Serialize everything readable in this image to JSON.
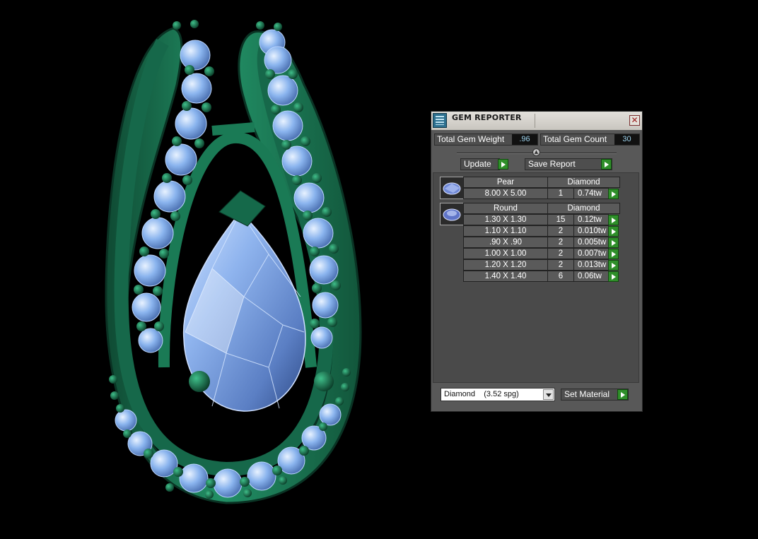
{
  "panel": {
    "title": "GEM REPORTER",
    "close_glyph": "✕",
    "total_weight_label": "Total Gem Weight",
    "total_weight_value": ".96",
    "total_count_label": "Total Gem Count",
    "total_count_value": "30",
    "update_label": "Update",
    "save_report_label": "Save Report",
    "groups": [
      {
        "icon": "pear-gem-icon",
        "shape": "Pear",
        "material": "Diamond",
        "rows": [
          {
            "size": "8.00 X 5.00",
            "count": "1",
            "weight": "0.74tw"
          }
        ]
      },
      {
        "icon": "round-gem-icon",
        "shape": "Round",
        "material": "Diamond",
        "rows": [
          {
            "size": "1.30 X 1.30",
            "count": "15",
            "weight": "0.12tw"
          },
          {
            "size": "1.10 X 1.10",
            "count": "2",
            "weight": "0.010tw"
          },
          {
            "size": ".90 X .90",
            "count": "2",
            "weight": "0.005tw"
          },
          {
            "size": "1.00 X 1.00",
            "count": "2",
            "weight": "0.007tw"
          },
          {
            "size": "1.20 X 1.20",
            "count": "2",
            "weight": "0.013tw"
          },
          {
            "size": "1.40 X 1.40",
            "count": "6",
            "weight": "0.06tw"
          }
        ]
      }
    ],
    "material_select_value": "Diamond    (3.52 spg)",
    "set_material_label": "Set Material"
  },
  "colors": {
    "metal": "#1f7a55",
    "gem": "#8ab4ee",
    "panel_bg": "#585858",
    "accent_green": "#2f8f2a"
  }
}
